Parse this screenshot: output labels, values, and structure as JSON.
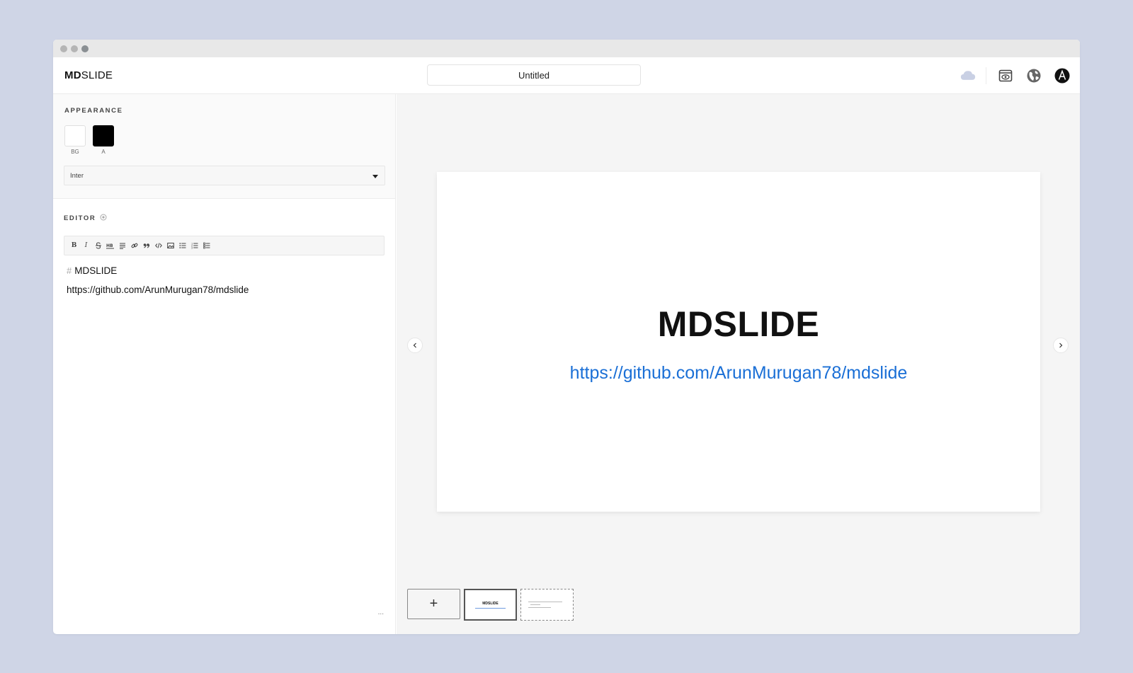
{
  "app": {
    "logo_bold": "MD",
    "logo_rest": "SLIDE",
    "doc_title": "Untitled"
  },
  "appearance": {
    "label": "APPEARANCE",
    "swatches": [
      {
        "label": "BG",
        "color": "#ffffff"
      },
      {
        "label": "A",
        "color": "#000000"
      }
    ],
    "font": "Inter"
  },
  "editor": {
    "label": "EDITOR",
    "heading_marker": "#",
    "heading_text": "MDSLIDE",
    "body_text": "https://github.com/ArunMurugan78/mdslide",
    "more": "...",
    "toolbar": [
      "bold",
      "italic",
      "strikethrough",
      "heading",
      "paragraph",
      "link",
      "quote",
      "code",
      "image",
      "bullet-list",
      "numbered-list",
      "task-list"
    ]
  },
  "slide": {
    "title": "MDSLIDE",
    "link": "https://github.com/ArunMurugan78/mdslide",
    "link_color": "#1a6fd6"
  },
  "thumbnails": {
    "add_label": "+",
    "slides": [
      {
        "title": "MDSLIDE",
        "selected": true
      },
      {
        "title": "",
        "selected": false
      }
    ]
  },
  "icons": [
    "cloud-icon",
    "preview-icon",
    "globe-icon",
    "avatar"
  ]
}
